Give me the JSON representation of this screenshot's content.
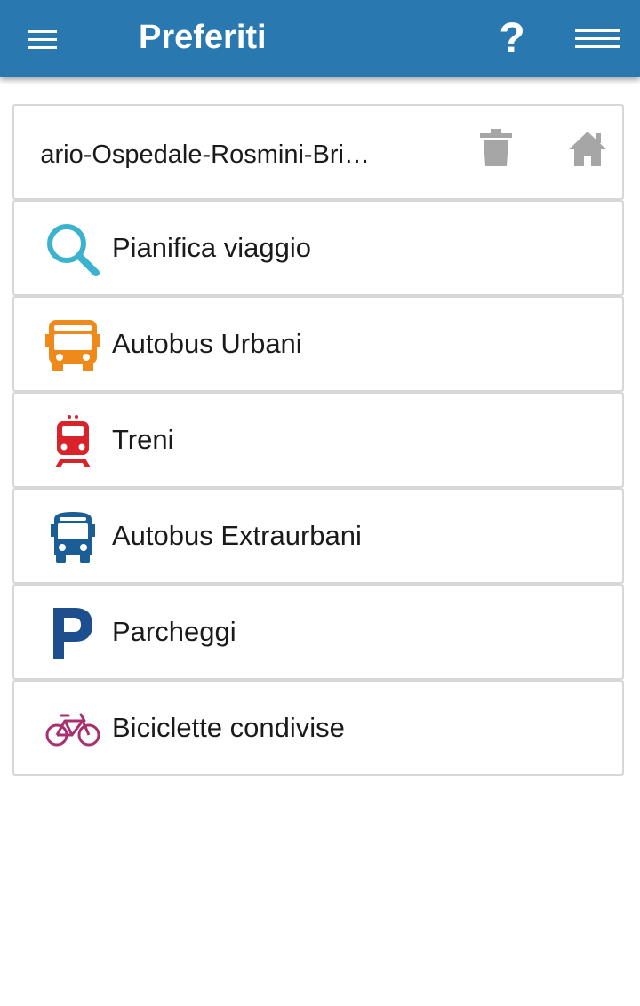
{
  "header": {
    "title": "Preferiti",
    "help_label": "?"
  },
  "favorite": {
    "label": "ario-Ospedale-Rosmini-Bri…"
  },
  "menu": [
    {
      "label": "Pianifica viaggio",
      "icon": "search-icon",
      "color": "#3bb3cf"
    },
    {
      "label": "Autobus Urbani",
      "icon": "bus-icon",
      "color": "#ef8a1a"
    },
    {
      "label": "Treni",
      "icon": "train-icon",
      "color": "#d9222a"
    },
    {
      "label": "Autobus Extraurbani",
      "icon": "bus-icon",
      "color": "#1a5e95"
    },
    {
      "label": "Parcheggi",
      "icon": "parking-icon",
      "color": "#1d4f8f"
    },
    {
      "label": "Biciclette condivise",
      "icon": "bicycle-icon",
      "color": "#a8306e"
    }
  ],
  "colors": {
    "appbar": "#2a78b0",
    "icon_gray": "#a6a6a6"
  }
}
